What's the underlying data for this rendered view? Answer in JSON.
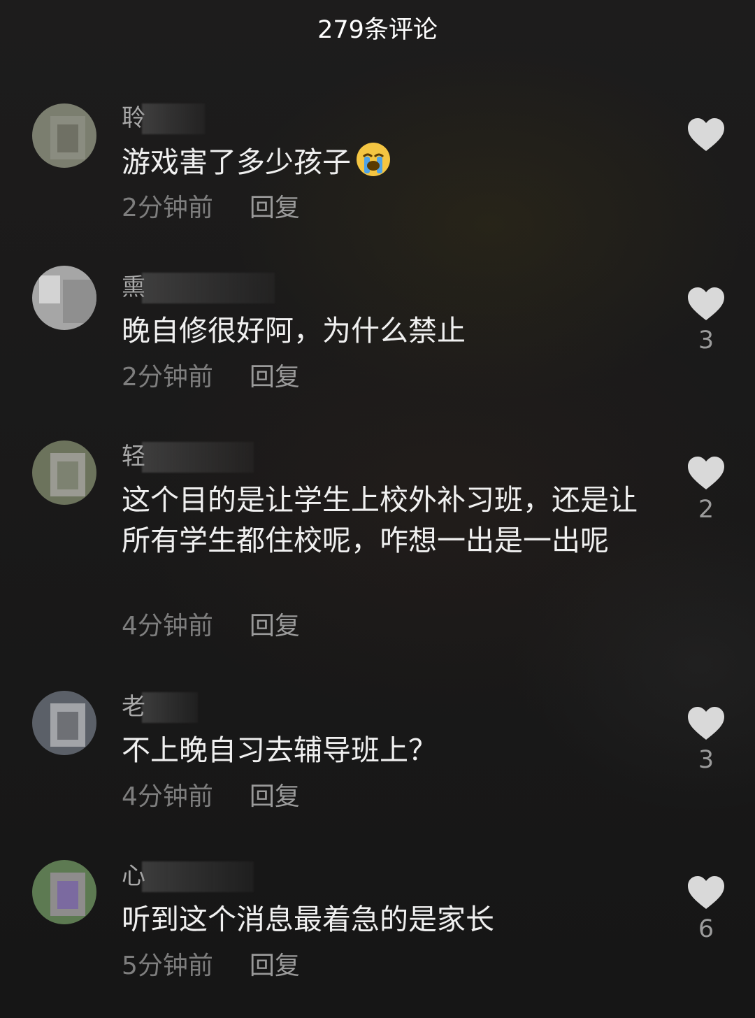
{
  "header": {
    "title": "279条评论"
  },
  "comments": [
    {
      "name": "聆",
      "text": "游戏害了多少孩子",
      "emoji": "loudly-crying-face",
      "time": "2分钟前",
      "reply": "回复",
      "likes": ""
    },
    {
      "name": "熏",
      "text": "晚自修很好阿，为什么禁止",
      "time": "2分钟前",
      "reply": "回复",
      "likes": "3"
    },
    {
      "name": "轻",
      "text": "这个目的是让学生上校外补习班，还是让所有学生都住校呢，咋想一出是一出呢",
      "time": "4分钟前",
      "reply": "回复",
      "likes": "2"
    },
    {
      "name": "老",
      "text": "不上晚自习去辅导班上？",
      "time": "4分钟前",
      "reply": "回复",
      "likes": "3"
    },
    {
      "name": "心",
      "text": "听到这个消息最着急的是家长",
      "time": "5分钟前",
      "reply": "回复",
      "likes": "6"
    }
  ],
  "colors": {
    "background": "#1a1919",
    "text": "#f0f0f0",
    "meta": "#7e7e7e",
    "heart": "#d9d9d9"
  },
  "icons": {
    "like": "heart-icon"
  }
}
